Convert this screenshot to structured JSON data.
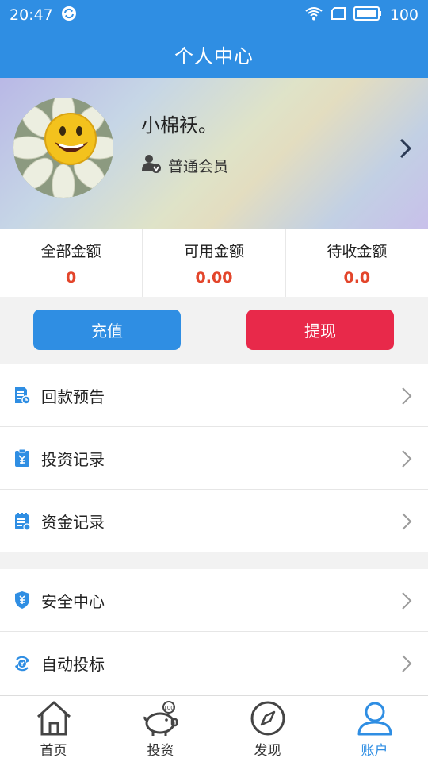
{
  "status_bar": {
    "time": "20:47",
    "battery": "100"
  },
  "header": {
    "title": "个人中心"
  },
  "profile": {
    "name": "小棉袄。",
    "member_level": "普通会员"
  },
  "stats": [
    {
      "label": "全部金额",
      "value": "0"
    },
    {
      "label": "可用金额",
      "value": "0.00"
    },
    {
      "label": "待收金额",
      "value": "0.0"
    }
  ],
  "actions": {
    "recharge": "充值",
    "withdraw": "提现"
  },
  "menu_group_1": [
    {
      "label": "回款预告",
      "icon": "repayment-forecast-icon"
    },
    {
      "label": "投资记录",
      "icon": "investment-record-icon"
    },
    {
      "label": "资金记录",
      "icon": "fund-record-icon"
    }
  ],
  "menu_group_2": [
    {
      "label": "安全中心",
      "icon": "security-shield-icon"
    },
    {
      "label": "自动投标",
      "icon": "auto-bid-icon"
    }
  ],
  "tabs": [
    {
      "label": "首页",
      "icon": "home-icon"
    },
    {
      "label": "投资",
      "icon": "piggy-bank-icon"
    },
    {
      "label": "发现",
      "icon": "compass-icon"
    },
    {
      "label": "账户",
      "icon": "user-icon"
    }
  ],
  "colors": {
    "primary": "#2f8ee3",
    "danger": "#e8294a",
    "amount": "#e3452b"
  }
}
